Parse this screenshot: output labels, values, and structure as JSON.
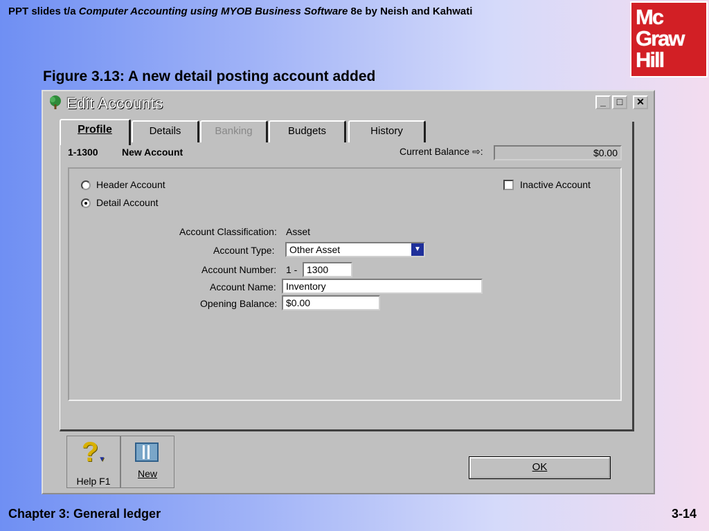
{
  "slide": {
    "header_prefix": "PPT slides t/a",
    "header_book": "Computer Accounting using MYOB Business Software",
    "header_suffix": "8e by Neish and Kahwati",
    "logo": [
      "Mc",
      "Graw",
      "Hill"
    ],
    "figure_title": "Figure 3.13: A new detail posting account added",
    "footer_left": "Chapter 3: General ledger",
    "footer_right": "3-14"
  },
  "window": {
    "title": "Edit Accounts",
    "minimize_icon": "minimize-icon",
    "maximize_icon": "maximize-icon",
    "close_icon": "close-icon"
  },
  "tabs": [
    {
      "label": "Profile"
    },
    {
      "label": "Details"
    },
    {
      "label": "Banking"
    },
    {
      "label": "Budgets"
    },
    {
      "label": "History"
    }
  ],
  "account_header": {
    "number": "1-1300",
    "name": "New Account",
    "balance_label": "Current Balance",
    "balance_value": "$0.00"
  },
  "profile": {
    "header_account": "Header Account",
    "detail_account": "Detail Account",
    "inactive_account": "Inactive Account",
    "classification_label": "Account Classification:",
    "classification_value": "Asset",
    "type_label": "Account Type:",
    "type_value": "Other Asset",
    "number_label": "Account Number:",
    "number_prefix": "1 -",
    "number_value": "1300",
    "name_label": "Account Name:",
    "name_value": "Inventory",
    "opening_label": "Opening Balance:",
    "opening_value": "$0.00"
  },
  "buttons": {
    "help": "Help F1",
    "new": "New",
    "ok": "OK"
  },
  "colors": {
    "window_bg": "#c0c0c0",
    "logo_red": "#d21f25",
    "dropdown_blue": "#1e2f9a"
  }
}
